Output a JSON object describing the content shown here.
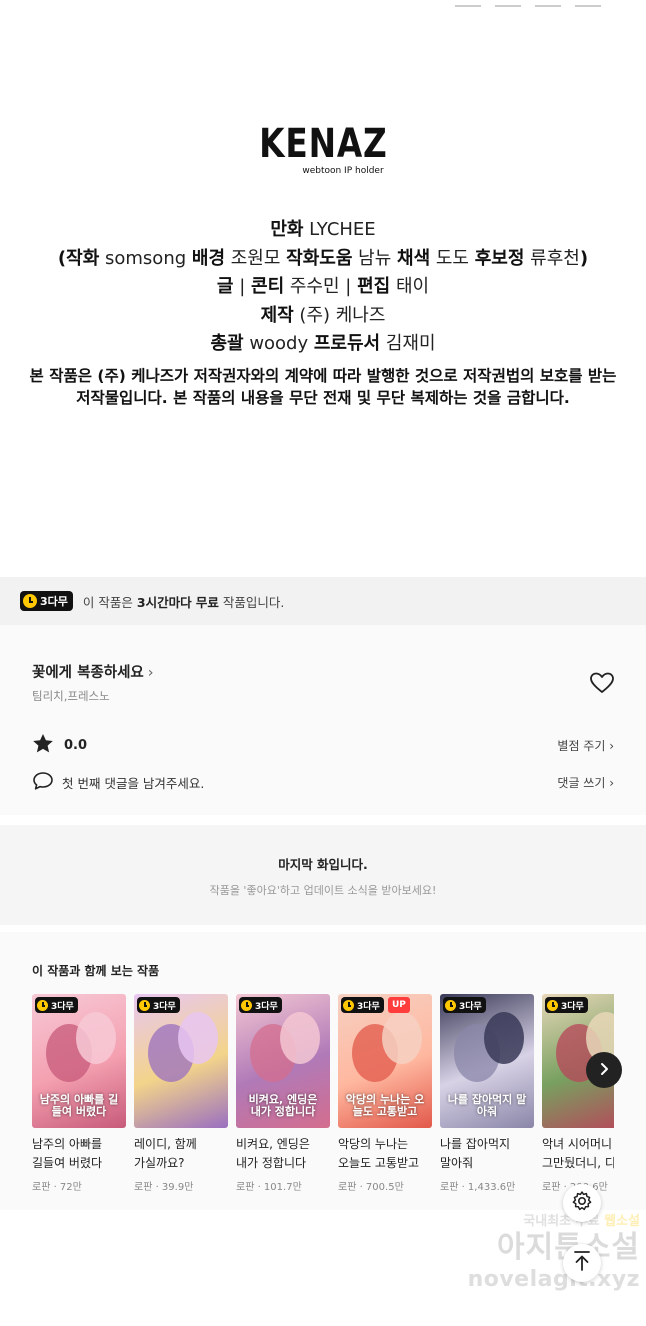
{
  "credits": {
    "logo_main": "KENAZ",
    "logo_sub": "webtoon IP holder",
    "line1": {
      "label": "만화",
      "value": "LYCHEE"
    },
    "line2": {
      "open": "(",
      "k1": "작화",
      "v1": "somsong",
      "k2": "배경",
      "v2": "조원모",
      "k3": "작화도움",
      "v3": "남뉴",
      "k4": "채색",
      "v4": "도도",
      "k5": "후보정",
      "v5": "류후천",
      "close": ")"
    },
    "line3": {
      "k1": "글",
      "sep1": "|",
      "k2": "콘티",
      "v2": "주수민",
      "sep2": "|",
      "k3": "편집",
      "v3": "태이"
    },
    "line4": {
      "label": "제작",
      "value": "(주) 케나즈"
    },
    "line5": {
      "k1": "총괄",
      "v1": "woody",
      "k2": "프로듀서",
      "v2": "김재미"
    },
    "notice": "본 작품은 (주) 케나즈가 저작권자와의 계약에 따라 발행한 것으로 저작권법의 보호를 받는 저작물입니다. 본 작품의 내용을 무단 전재 및 무단 복제하는 것을 금합니다."
  },
  "free_banner": {
    "badge": "3다무",
    "text_pre": "이 작품은",
    "text_bold": "3시간마다 무료",
    "text_post": "작품입니다."
  },
  "series": {
    "title": "꽃에게 복종하세요",
    "chevron": "›",
    "publisher": "팀리치,프레스노",
    "rating": "0.0",
    "rate_link": "별점 주기 ›",
    "comment_prompt": "첫 번째 댓글을 남겨주세요.",
    "comment_link": "댓글 쓰기 ›"
  },
  "last_episode": {
    "title": "마지막 화입니다.",
    "subtitle": "작품을 '좋아요'하고 업데이트 소식을 받아보세요!"
  },
  "recommendations": {
    "heading": "이 작품과 함께 보는 작품",
    "items": [
      {
        "title": "남주의 아빠를 길들여 버렸다",
        "meta": "로판 · 72만",
        "badge": "3다무",
        "up": "",
        "cover": "남주의 아빠를 길들여 버렸다",
        "colors": [
          "#f7c9d6",
          "#c75a7a",
          "#f4a0b0"
        ]
      },
      {
        "title": "레이디, 함께 가실까요?",
        "meta": "로판 · 39.9만",
        "badge": "3다무",
        "up": "",
        "cover": "",
        "colors": [
          "#e8c6f2",
          "#9a6fc0",
          "#f3d48a"
        ]
      },
      {
        "title": "비켜요, 엔딩은 내가 정합니다",
        "meta": "로판 · 101.7만",
        "badge": "3다무",
        "up": "",
        "cover": "비켜요, 엔딩은 내가 정합니다",
        "colors": [
          "#f3c7d2",
          "#d46d8e",
          "#b07ab8"
        ]
      },
      {
        "title": "악당의 누나는 오늘도 고통받고",
        "meta": "로판 · 700.5만",
        "badge": "3다무",
        "up": "UP",
        "cover": "악당의 누나는 오늘도 고통받고",
        "colors": [
          "#f6d0c2",
          "#e2584a",
          "#ffb8a0"
        ]
      },
      {
        "title": "나를 잡아먹지 말아줘",
        "meta": "로판 · 1,433.6만",
        "badge": "3다무",
        "up": "",
        "cover": "나를 잡아먹지 말아줘",
        "colors": [
          "#3a3a58",
          "#8a86a8",
          "#d8d2e6"
        ]
      },
      {
        "title": "악녀 시어머니 그만뒀더니, 디",
        "meta": "로판 · 200.6만",
        "badge": "3다무",
        "up": "",
        "cover": "",
        "colors": [
          "#e7d7b8",
          "#b8455a",
          "#78a060"
        ]
      }
    ]
  },
  "watermark": {
    "line1_a": "국내최초 무료",
    "line1_b": "웹소설",
    "line2": "아지툰소설",
    "line3": "novelagit.xyz"
  },
  "icons": {
    "heart": "heart-icon",
    "star": "star-icon",
    "comment": "comment-bubble-icon",
    "clock": "clock-icon",
    "next": "chevron-right-icon",
    "settings": "gear-icon",
    "scroll_top": "arrow-up-icon"
  }
}
